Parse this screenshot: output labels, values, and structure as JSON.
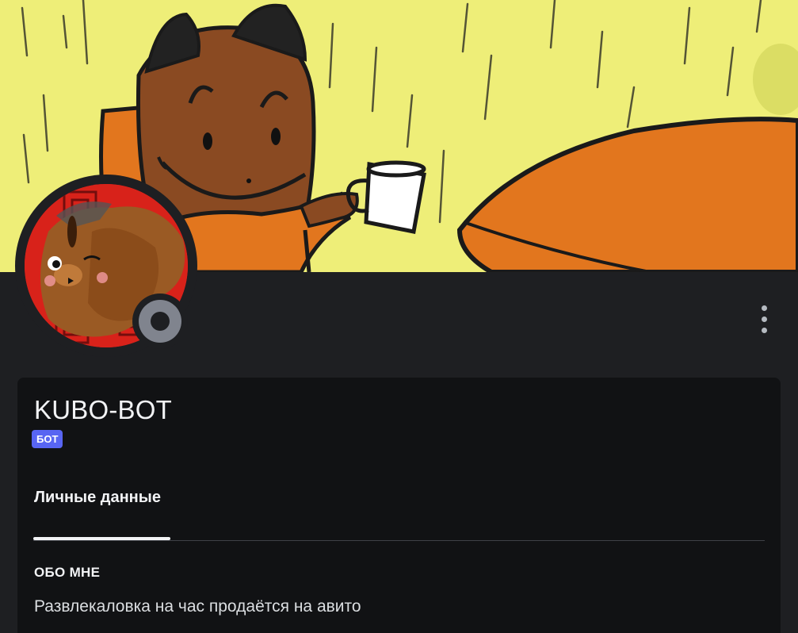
{
  "profile": {
    "username": "KUBO-BOT",
    "badge": "БОТ",
    "status": "offline",
    "more_icon": "more-vertical-icon"
  },
  "tabs": [
    {
      "label": "Личные данные",
      "active": true
    }
  ],
  "about": {
    "title": "ОБО МНЕ",
    "text": "Развлекаловка на час продаётся на авито"
  },
  "colors": {
    "background": "#1e1f22",
    "card": "#111214",
    "badge": "#5865f2",
    "banner": "#eeee78",
    "status_offline": "#80848e"
  }
}
